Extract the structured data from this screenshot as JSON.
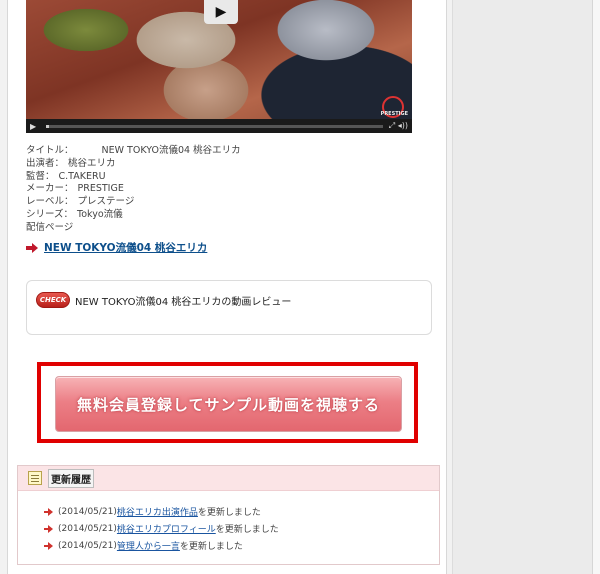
{
  "player": {
    "play_glyph": "▶",
    "watermark_text": "PRESTIGE",
    "progress": 0.01,
    "control_play_glyph": "▶",
    "control_icons": "⤢ ◂))"
  },
  "info": {
    "title_label": "タイトル：",
    "title_value": "NEW TOKYO流儀04 桃谷エリカ",
    "performer_label": "出演者：",
    "performer_value": "桃谷エリカ",
    "director_label": "監督：",
    "director_value": "C.TAKERU",
    "maker_label": "メーカー：",
    "maker_value": "PRESTIGE",
    "label_label": "レーベル：",
    "label_value": "プレステージ",
    "series_label": "シリーズ：",
    "series_value": "Tokyo流儀",
    "page_label": "配信ページ"
  },
  "main_link": {
    "text": "NEW TOKYO流儀04 桃谷エリカ"
  },
  "review": {
    "badge": "CHECK",
    "title": "NEW TOKYO流儀04 桃谷エリカの動画レビュー"
  },
  "cta": {
    "label": "無料会員登録してサンプル動画を視聴する"
  },
  "history": {
    "title": "更新履歴",
    "items": [
      {
        "date": "(2014/05/21)",
        "link": "桃谷エリカ出演作品",
        "suffix": "を更新しました"
      },
      {
        "date": "(2014/05/21)",
        "link": "桃谷エリカプロフィール",
        "suffix": "を更新しました"
      },
      {
        "date": "(2014/05/21)",
        "link": "管理人から一言",
        "suffix": "を更新しました"
      }
    ]
  },
  "colors": {
    "accent_red": "#e00000",
    "link_blue": "#0d4f8b",
    "cta_pink": "#ec7f86"
  }
}
